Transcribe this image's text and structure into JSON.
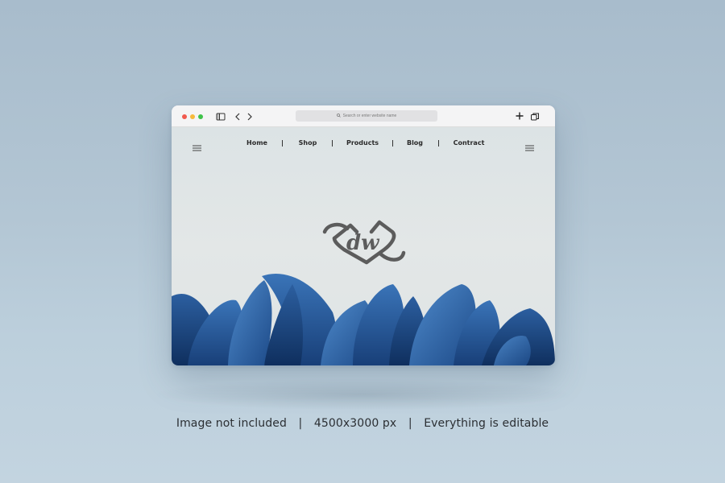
{
  "browser": {
    "address_placeholder": "Search or enter website name"
  },
  "site": {
    "nav": [
      {
        "label": "Home"
      },
      {
        "label": "Shop"
      },
      {
        "label": "Products"
      },
      {
        "label": "Blog"
      },
      {
        "label": "Contract"
      }
    ],
    "logo_text": "dw"
  },
  "caption": {
    "item1": "Image not included",
    "sep": "|",
    "item2": "4500x3000 px",
    "item3": "Everything is editable"
  },
  "colors": {
    "accent_blue": "#2f63a8",
    "logo_gray": "#5c5c5c",
    "close_red": "#f15a4f",
    "minimize_yellow": "#f6b93b",
    "maximize_green": "#3fc24a"
  },
  "icons": [
    "sidebar-icon",
    "chevron-left-icon",
    "chevron-right-icon",
    "search-icon",
    "plus-icon",
    "tabs-icon",
    "hamburger-menu-icon"
  ]
}
